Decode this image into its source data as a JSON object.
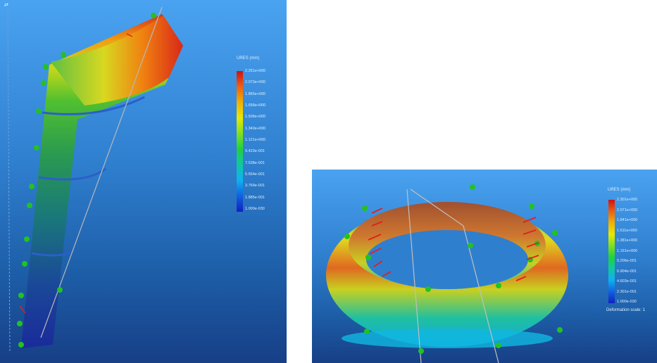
{
  "left_view": {
    "legend": {
      "title": "URES (mm)",
      "ticks": [
        "2.251e+000",
        "2.073e+000",
        "1.865e+000",
        "1.658e+000",
        "1.508e+000",
        "1.340e+000",
        "1.121e+000",
        "9.423e-001",
        "7.538e-001",
        "5.654e-001",
        "3.769e-001",
        "1.885e-001",
        "1.000e-030"
      ]
    }
  },
  "right_view": {
    "legend": {
      "title": "URES (mm)",
      "ticks": [
        "2.301e+000",
        "2.071e+000",
        "1.841e+000",
        "1.611e+000",
        "1.381e+000",
        "1.151e+000",
        "9.206e-001",
        "6.904e-001",
        "4.603e-001",
        "2.301e-001",
        "1.000e-030"
      ],
      "footer": "Deformation scale: 1"
    }
  },
  "colors": {
    "legend_gradient": [
      "#d01010",
      "#f06010",
      "#f0b000",
      "#e8e800",
      "#80e020",
      "#20d040",
      "#10c8a0",
      "#10b0f0",
      "#1060e0",
      "#1020c0"
    ],
    "background_top": "#4aa3f0",
    "background_bottom": "#173f86",
    "fixture_icon": "#22c222",
    "load_arrow": "#e02020"
  },
  "icons": [
    "fixture-arrow-icon",
    "load-arrow-icon",
    "axis-triad-icon"
  ]
}
